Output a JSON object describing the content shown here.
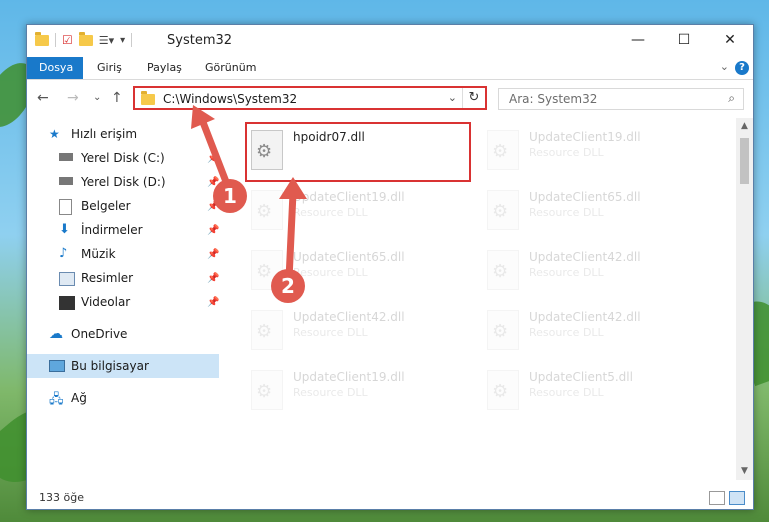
{
  "window": {
    "title": "System32",
    "controls": {
      "minimize": "—",
      "maximize": "☐",
      "close": "✕"
    }
  },
  "ribbon": {
    "tabs": [
      "Dosya",
      "Giriş",
      "Paylaş",
      "Görünüm"
    ],
    "help": "?"
  },
  "address": {
    "path": "C:\\Windows\\System32",
    "search_placeholder": "Ara: System32"
  },
  "nav_pane": {
    "items": [
      {
        "label": "Hızlı erişim",
        "icon": "star-icon"
      },
      {
        "label": "Yerel Disk (C:)",
        "icon": "drive-icon",
        "pinned": true
      },
      {
        "label": "Yerel Disk (D:)",
        "icon": "drive-icon",
        "pinned": true
      },
      {
        "label": "Belgeler",
        "icon": "documents-icon",
        "pinned": true
      },
      {
        "label": "İndirmeler",
        "icon": "download-icon",
        "pinned": true
      },
      {
        "label": "Müzik",
        "icon": "music-icon",
        "pinned": true
      },
      {
        "label": "Resimler",
        "icon": "pictures-icon",
        "pinned": true
      },
      {
        "label": "Videolar",
        "icon": "video-icon",
        "pinned": true
      },
      {
        "label": "OneDrive",
        "icon": "cloud-icon"
      },
      {
        "label": "Bu bilgisayar",
        "icon": "computer-icon",
        "selected": true
      },
      {
        "label": "Ağ",
        "icon": "network-icon"
      }
    ]
  },
  "files": {
    "highlighted": {
      "name": "hpoidr07.dll",
      "desc": ""
    },
    "faded": [
      {
        "name": "UpdateClient19.dll",
        "desc": "Resource DLL"
      },
      {
        "name": "UpdateClient19.dll",
        "desc": "Resource DLL"
      },
      {
        "name": "UpdateClient65.dll",
        "desc": "Resource DLL"
      },
      {
        "name": "UpdateClient65.dll",
        "desc": "Resource DLL"
      },
      {
        "name": "UpdateClient42.dll",
        "desc": "Resource DLL"
      },
      {
        "name": "UpdateClient42.dll",
        "desc": "Resource DLL"
      },
      {
        "name": "UpdateClient42.dll",
        "desc": "Resource DLL"
      },
      {
        "name": "UpdateClient19.dll",
        "desc": "Resource DLL"
      },
      {
        "name": "UpdateClient5.dll",
        "desc": "Resource DLL"
      }
    ]
  },
  "status": {
    "count": "133 öğe"
  },
  "annotations": {
    "step1": "1",
    "step2": "2"
  },
  "colors": {
    "accent": "#1979ca",
    "highlight": "#d93232",
    "badge": "#e05a4f"
  }
}
